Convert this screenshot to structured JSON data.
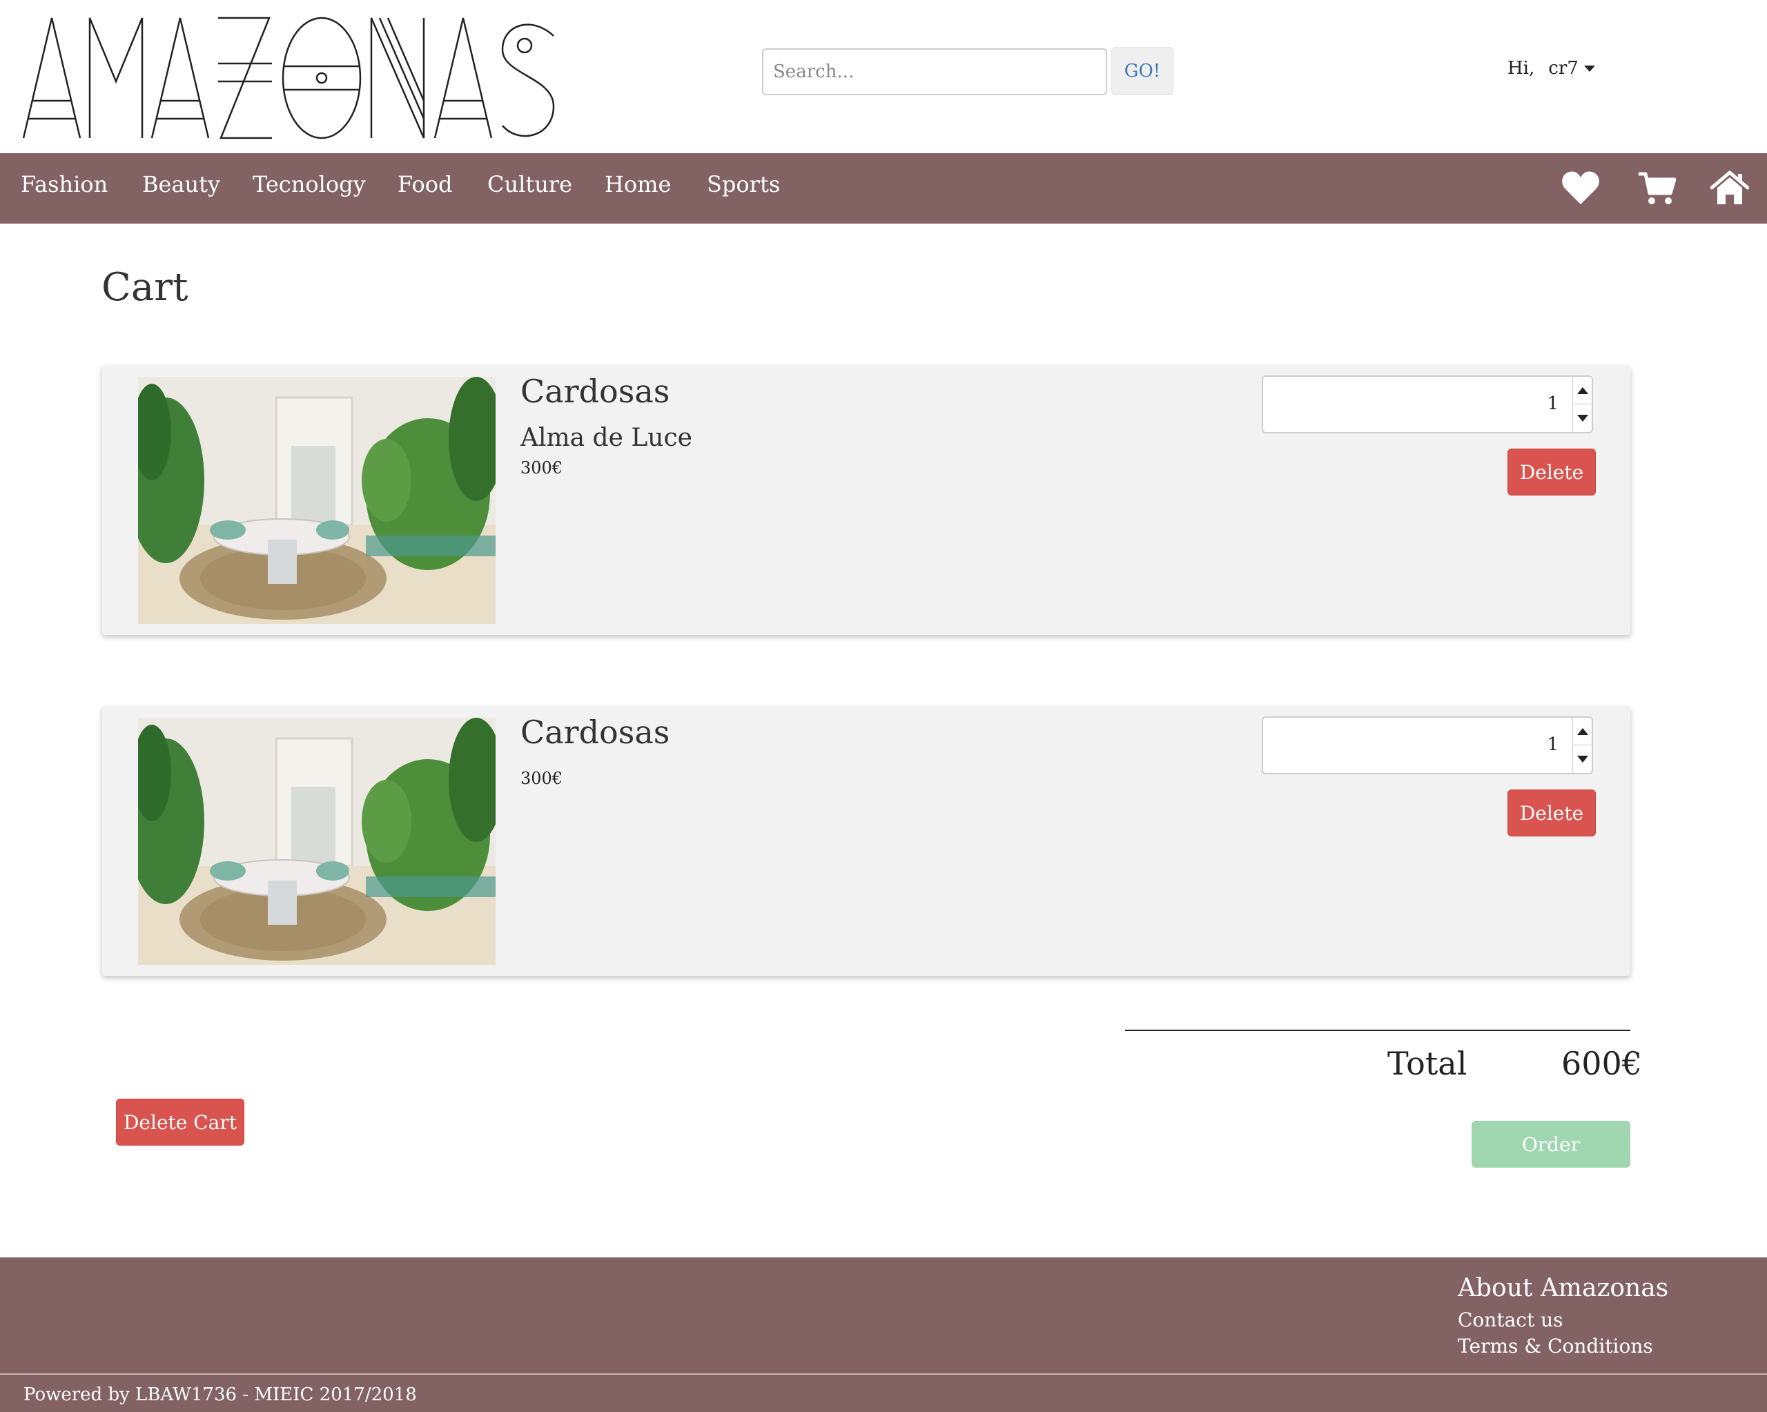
{
  "header": {
    "logo_text": "AMAZONAS",
    "search": {
      "placeholder": "Search...",
      "value": ""
    },
    "go_label": "GO!",
    "greeting": "Hi,",
    "username": "cr7"
  },
  "nav": {
    "categories": [
      "Fashion",
      "Beauty",
      "Tecnology",
      "Food",
      "Culture",
      "Home",
      "Sports"
    ],
    "icons": [
      "heart-icon",
      "cart-icon",
      "home-icon"
    ]
  },
  "cart": {
    "title": "Cart",
    "items": [
      {
        "name": "Cardosas",
        "subtitle": "Alma de Luce",
        "price": "300€",
        "quantity": "1",
        "delete_label": "Delete"
      },
      {
        "name": "Cardosas",
        "subtitle": "",
        "price": "300€",
        "quantity": "1",
        "delete_label": "Delete"
      }
    ],
    "total_label": "Total",
    "total_value": "600€",
    "delete_cart_label": "Delete Cart",
    "order_label": "Order"
  },
  "footer": {
    "heading": "About Amazonas",
    "links": [
      "Contact us",
      "Terms & Conditions"
    ],
    "credit": "Powered by LBAW1736 - MIEIC 2017/2018"
  },
  "colors": {
    "brand": "#836264",
    "danger": "#d9534f",
    "success_disabled": "#a0d6b0",
    "link": "#3a78b8"
  }
}
